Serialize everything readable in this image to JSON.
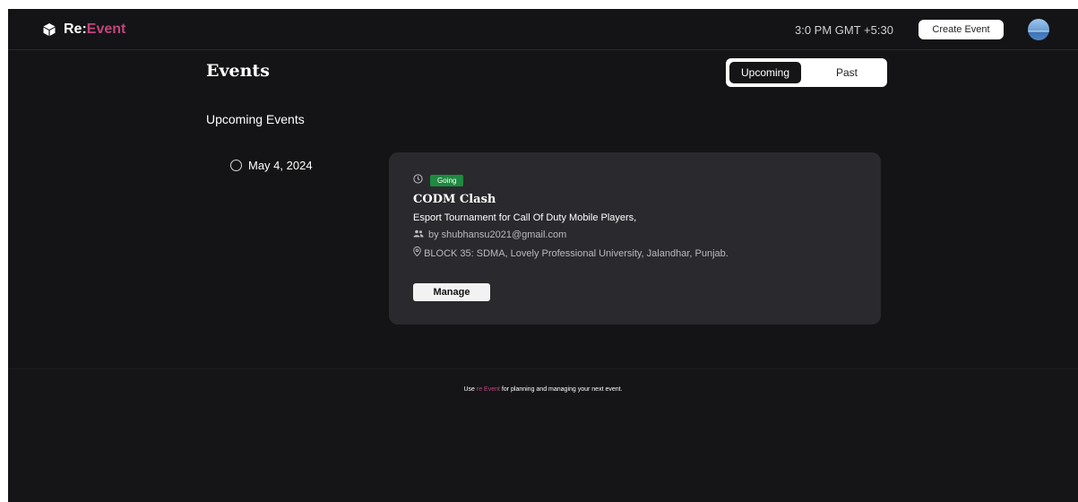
{
  "header": {
    "brand_prefix": "Re:",
    "brand_suffix": "Event",
    "time": "3:0 PM GMT +5:30",
    "create_label": "Create Event"
  },
  "main": {
    "title": "Events",
    "tabs": [
      {
        "label": "Upcoming",
        "active": true
      },
      {
        "label": "Past",
        "active": false
      }
    ],
    "section_title": "Upcoming Events",
    "timeline": [
      {
        "date": "May 4, 2024",
        "event": {
          "status": "Going",
          "title": "CODM Clash",
          "description": "Esport Tournament for Call Of Duty Mobile Players,",
          "host": "by shubhansu2021@gmail.com",
          "location": "BLOCK 35: SDMA, Lovely Professional University, Jalandhar, Punjab.",
          "manage_label": "Manage"
        }
      }
    ]
  },
  "footer": {
    "prefix": "Use",
    "brand": "re Event",
    "suffix": "for planning and managing your next event."
  },
  "colors": {
    "background": "#141416",
    "card": "#2a2a2e",
    "accent": "#c2457e",
    "status_going": "#1f8a40"
  },
  "icons": [
    "logo-cube-icon",
    "clock-icon",
    "users-icon",
    "location-pin-icon"
  ]
}
